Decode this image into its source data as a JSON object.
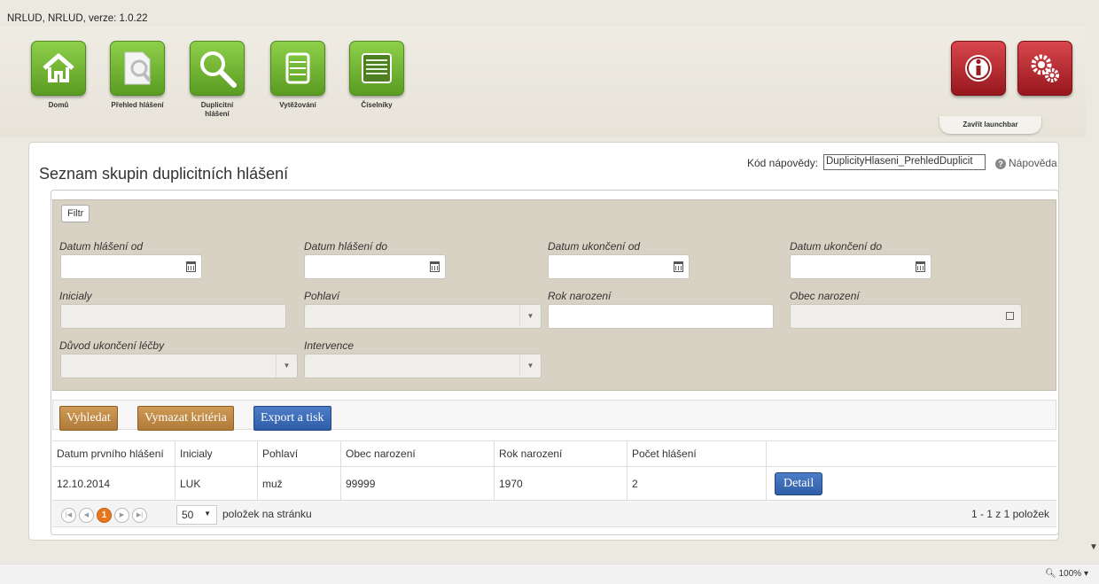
{
  "app": {
    "title": "NRLUD, NRLUD, verze: 1.0.22"
  },
  "launchbar": {
    "tiles": [
      {
        "label": "Domů"
      },
      {
        "label": "Přehled hlášení"
      },
      {
        "label": "Duplicitní hlášení"
      },
      {
        "label": "Vytěžování"
      },
      {
        "label": "Číselníky"
      }
    ],
    "close_label": "Zavřít launchbar"
  },
  "page": {
    "title": "Seznam skupin duplicitních hlášení",
    "help_code_label": "Kód nápovědy:",
    "help_code_value": "DuplicityHlaseni_PrehledDuplicit",
    "help_link": "Nápověda"
  },
  "filter": {
    "legend": "Filtr",
    "fields": {
      "datum_hlaseni_od": "Datum hlášení od",
      "datum_hlaseni_do": "Datum hlášení do",
      "datum_ukonceni_od": "Datum ukončení od",
      "datum_ukonceni_do": "Datum ukončení do",
      "inicialy": "Inicialy",
      "pohlavi": "Pohlaví",
      "rok_narozeni": "Rok narození",
      "obec_narozeni": "Obec narození",
      "duvod_ukonceni": "Důvod ukončení léčby",
      "intervence": "Intervence"
    }
  },
  "toolbar": {
    "search": "Vyhledat",
    "clear": "Vymazat kritéria",
    "export": "Export a tisk"
  },
  "grid": {
    "columns": [
      "Datum prvního hlášení",
      "Inicialy",
      "Pohlaví",
      "Obec narození",
      "Rok narození",
      "Počet hlášení",
      ""
    ],
    "rows": [
      {
        "datum": "12.10.2014",
        "inicialy": "LUK",
        "pohlavi": "muž",
        "obec": "99999",
        "rok": "1970",
        "pocet": "2",
        "action": "Detail"
      }
    ]
  },
  "pager": {
    "current_page": "1",
    "page_size": "50",
    "per_page_text": "položek na stránku",
    "info": "1 - 1 z 1 položek"
  },
  "status": {
    "zoom": "100%"
  },
  "colors": {
    "tile_green": "#6fb02f",
    "tile_red": "#b3232a",
    "btn_orange": "#c08a45",
    "btn_blue": "#3d6db5",
    "pager_current": "#e8781f"
  }
}
